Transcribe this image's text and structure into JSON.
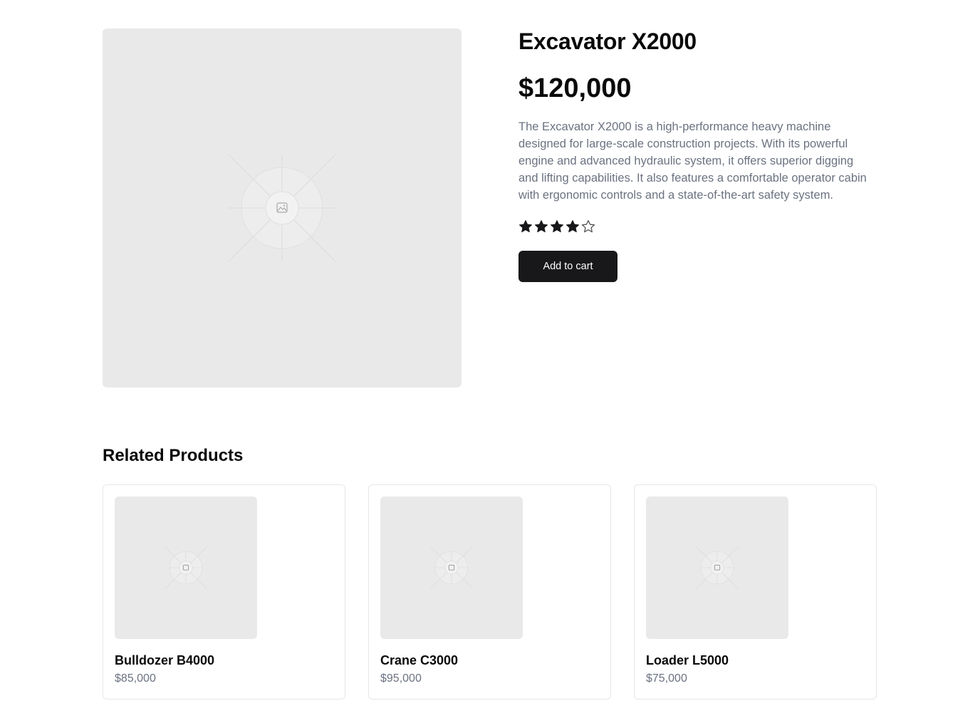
{
  "product": {
    "title": "Excavator X2000",
    "price": "$120,000",
    "description": "The Excavator X2000 is a high-performance heavy machine designed for large-scale construction projects. With its powerful engine and advanced hydraulic system, it offers superior digging and lifting capabilities. It also features a comfortable operator cabin with ergonomic controls and a state-of-the-art safety system.",
    "rating": 4,
    "rating_max": 5,
    "add_to_cart_label": "Add to cart",
    "image_icon": "image-placeholder-icon"
  },
  "related": {
    "title": "Related Products",
    "items": [
      {
        "name": "Bulldozer B4000",
        "price": "$85,000"
      },
      {
        "name": "Crane C3000",
        "price": "$95,000"
      },
      {
        "name": "Loader L5000",
        "price": "$75,000"
      }
    ]
  },
  "colors": {
    "button_bg": "#18181b",
    "placeholder_bg": "#e9e9e9",
    "muted_text": "#6b7280",
    "star_filled": "#18181b",
    "star_empty_stroke": "#555555"
  }
}
